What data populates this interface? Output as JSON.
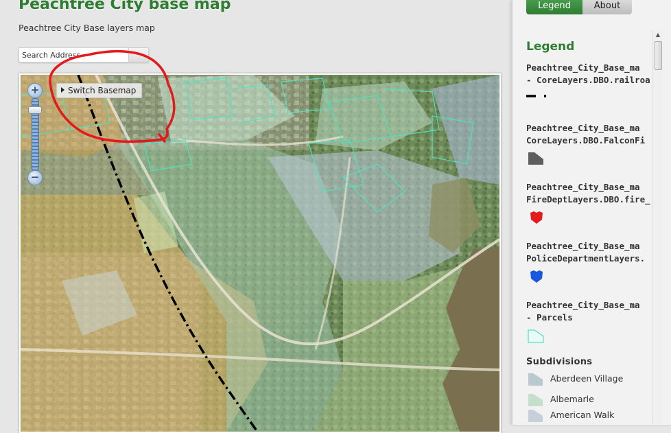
{
  "header": {
    "title": "Peachtree City base map",
    "subtitle": "Peachtree City Base layers map"
  },
  "search": {
    "value": "Search Address",
    "button_icon": "search-icon"
  },
  "map": {
    "zoom_in_label": "+",
    "zoom_out_label": "−",
    "basemap_button_label": "Switch Basemap",
    "annotation_color": "#e3191c"
  },
  "panel": {
    "tabs": [
      {
        "label": "Legend",
        "active": true
      },
      {
        "label": "About",
        "active": false
      }
    ],
    "legend_heading": "Legend",
    "layers": [
      {
        "title": "Peachtree_City_Base_ma\n- CoreLayers.DBO.railroa",
        "symbol": "railroad-line-icon"
      },
      {
        "title": "Peachtree_City_Base_ma\nCoreLayers.DBO.FalconFi",
        "symbol": "grey-polygon-icon"
      },
      {
        "title": "Peachtree_City_Base_ma\nFireDeptLayers.DBO.fire_",
        "symbol": "red-shield-icon"
      },
      {
        "title": "Peachtree_City_Base_ma\nPoliceDepartmentLayers.",
        "symbol": "blue-shield-icon"
      },
      {
        "title": "Peachtree_City_Base_ma\n- Parcels",
        "symbol": "parcel-outline-icon"
      }
    ],
    "subdivisions_title": "Subdivisions",
    "subdivisions": [
      {
        "label": "Aberdeen Village",
        "color": "#b9c9cf"
      },
      {
        "label": "Albemarle",
        "color": "#c6dfcd"
      },
      {
        "label": "American Walk",
        "color": "#c7cfd8"
      }
    ]
  },
  "colors": {
    "accent_green": "#2f7d32",
    "parcel_outline": "#4fe3c4",
    "fire_red": "#e31b1b",
    "police_blue": "#1a57e0"
  }
}
